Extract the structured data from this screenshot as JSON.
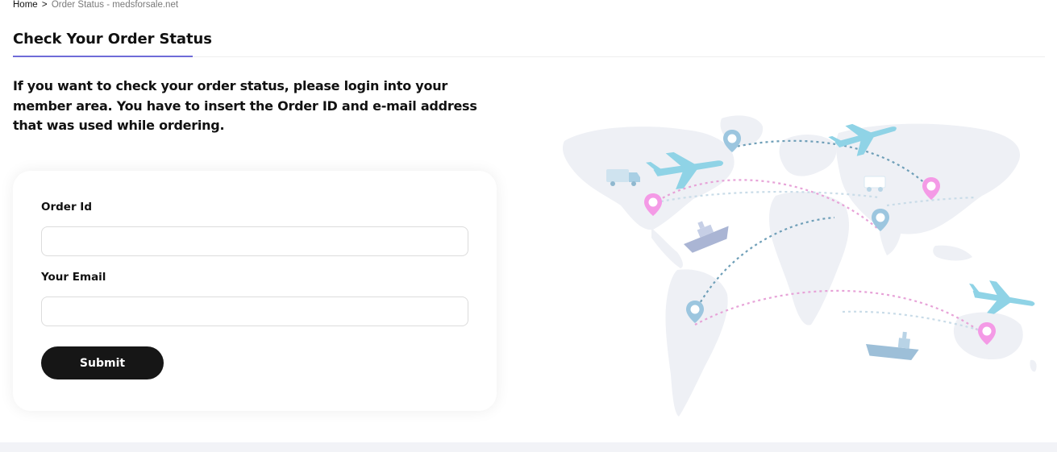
{
  "breadcrumb": {
    "home": "Home",
    "separator": ">",
    "current": "Order Status - medsforsale.net"
  },
  "page": {
    "title": "Check Your Order Status",
    "intro": "If you want to check your order status, please login into your member area. You have to insert the Order ID and e-mail address that was used while ordering."
  },
  "form": {
    "order_id_label": "Order Id",
    "order_id_value": "",
    "email_label": "Your Email",
    "email_value": "",
    "submit_label": "Submit"
  },
  "colors": {
    "accent_underline": "#6f6bd8",
    "button_bg": "#161616",
    "map_land": "#eef0f5",
    "pin_pink": "#f49ae6",
    "pin_blue": "#9cc6df",
    "route_pink": "#e7a3d8",
    "route_blue": "#6f9fb8"
  },
  "illustration": {
    "icons": [
      "world-map",
      "airplane-icon",
      "truck-icon",
      "ship-icon",
      "location-pin-icon"
    ]
  }
}
